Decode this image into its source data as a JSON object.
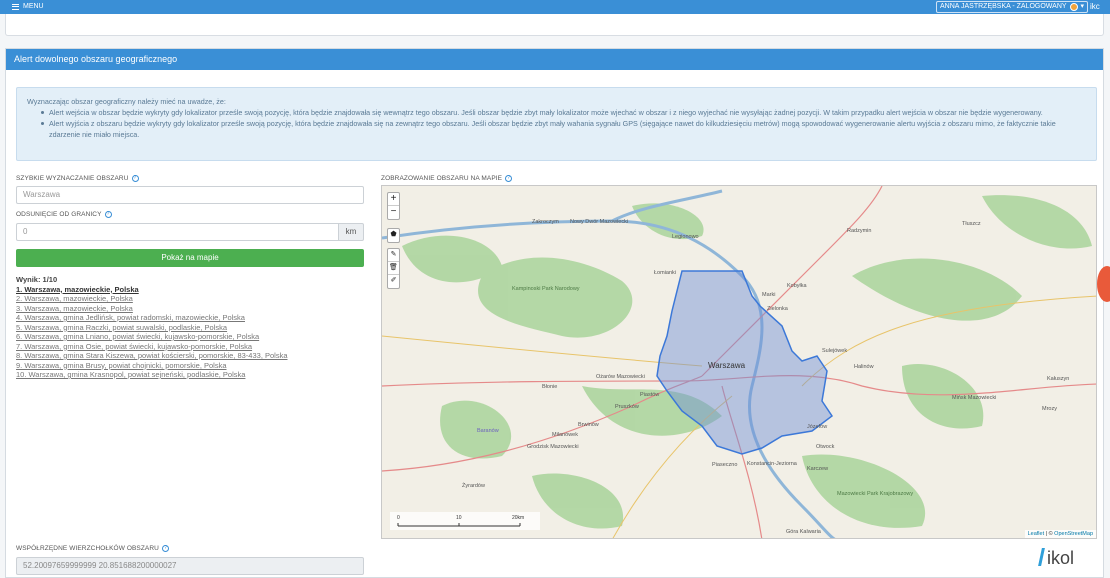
{
  "topbar": {
    "menu": "MENU",
    "user": "ANNA JASTRZĘBSKA - ZALOGOWANY",
    "brand": "ikc"
  },
  "panel": {
    "title": "Alert dowolnego obszaru geograficznego"
  },
  "info": {
    "intro": "Wyznaczając obszar geograficzny należy mieć na uwadze, że:",
    "bullets": [
      "Alert wejścia w obszar będzie wykryty gdy lokalizator prześle swoją pozycję, która będzie znajdowała się wewnątrz tego obszaru. Jeśli obszar będzie zbyt mały lokalizator może wjechać w obszar i z niego wyjechać nie wysyłając żadnej pozycji. W takim przypadku alert wejścia w obszar nie będzie wygenerowany.",
      "Alert wyjścia z obszaru będzie wykryty gdy lokalizator prześle swoją pozycję, która będzie znajdowała się na zewnątrz tego obszaru. Jeśli obszar będzie zbyt mały wahania sygnału GPS (sięgające nawet do kilkudziesięciu metrów) mogą spowodować wygenerowanie alertu wyjścia z obszaru mimo, że faktycznie takie zdarzenie nie miało miejsca."
    ]
  },
  "form": {
    "quick_label": "SZYBKIE WYZNACZANIE OBSZARU",
    "quick_placeholder": "Warszawa",
    "offset_label": "ODSUNIĘCIE OD GRANICY",
    "offset_placeholder": "0",
    "unit": "km",
    "show_button": "Pokaż na mapie",
    "coords_label": "WSPÓŁRZĘDNE WIERZCHOŁKÓW OBSZARU",
    "coords_value": "52.20097659999999 20.851688200000027"
  },
  "results": {
    "header": "Wynik: 1/10",
    "items": [
      "1. Warszawa, mazowieckie, Polska",
      "2. Warszawa, mazowieckie, Polska",
      "3. Warszawa, mazowieckie, Polska",
      "4. Warszawa, gmina Jedlińsk, powiat radomski, mazowieckie, Polska",
      "5. Warszawa, gmina Raczki, powiat suwalski, podlaskie, Polska",
      "6. Warszawa, gmina Lniano, powiat świecki, kujawsko-pomorskie, Polska",
      "7. Warszawa, gmina Osie, powiat świecki, kujawsko-pomorskie, Polska",
      "8. Warszawa, gmina Stara Kiszewa, powiat kościerski, pomorskie, 83-433, Polska",
      "9. Warszawa, gmina Brusy, powiat chojnicki, pomorskie, Polska",
      "10. Warszawa, gmina Krasnopol, powiat sejneński, podlaskie, Polska"
    ]
  },
  "map": {
    "label": "ZOBRAZOWANIE OBSZARU NA MAPIE",
    "zoom_in": "+",
    "zoom_out": "−",
    "scale": [
      "0",
      "10",
      "20km"
    ],
    "attribution_leaflet": "Leaflet",
    "attribution_osm": "OpenStreetMap",
    "places": [
      {
        "name": "Warszawa"
      },
      {
        "name": "Legionowo"
      },
      {
        "name": "Kampinoski Park Narodowy"
      },
      {
        "name": "Błonie"
      },
      {
        "name": "Ożarów Mazowiecki"
      },
      {
        "name": "Piastów"
      },
      {
        "name": "Pruszków"
      },
      {
        "name": "Piaseczno"
      },
      {
        "name": "Otwock"
      },
      {
        "name": "Józefów"
      },
      {
        "name": "Sulejówek"
      },
      {
        "name": "Zielonka"
      },
      {
        "name": "Marki"
      },
      {
        "name": "Kobyłka"
      },
      {
        "name": "Radzymin"
      },
      {
        "name": "Tłuszcz"
      },
      {
        "name": "Halinów"
      },
      {
        "name": "Mińsk Mazowiecki"
      },
      {
        "name": "Kałuszyn"
      },
      {
        "name": "Grodzisk Mazowiecki"
      },
      {
        "name": "Milanówek"
      },
      {
        "name": "Brwinów"
      },
      {
        "name": "Żyrardów"
      },
      {
        "name": "Konstancin-Jeziorna"
      },
      {
        "name": "Karczew"
      },
      {
        "name": "Łomianki"
      },
      {
        "name": "Nowy Dwór Mazowiecki"
      },
      {
        "name": "Zakroczym"
      },
      {
        "name": "Mazowiecki Park Krajobrazowy"
      },
      {
        "name": "Baranów"
      },
      {
        "name": "Mrozy"
      },
      {
        "name": "Góra Kalwaria"
      }
    ]
  },
  "logo": "ikol"
}
